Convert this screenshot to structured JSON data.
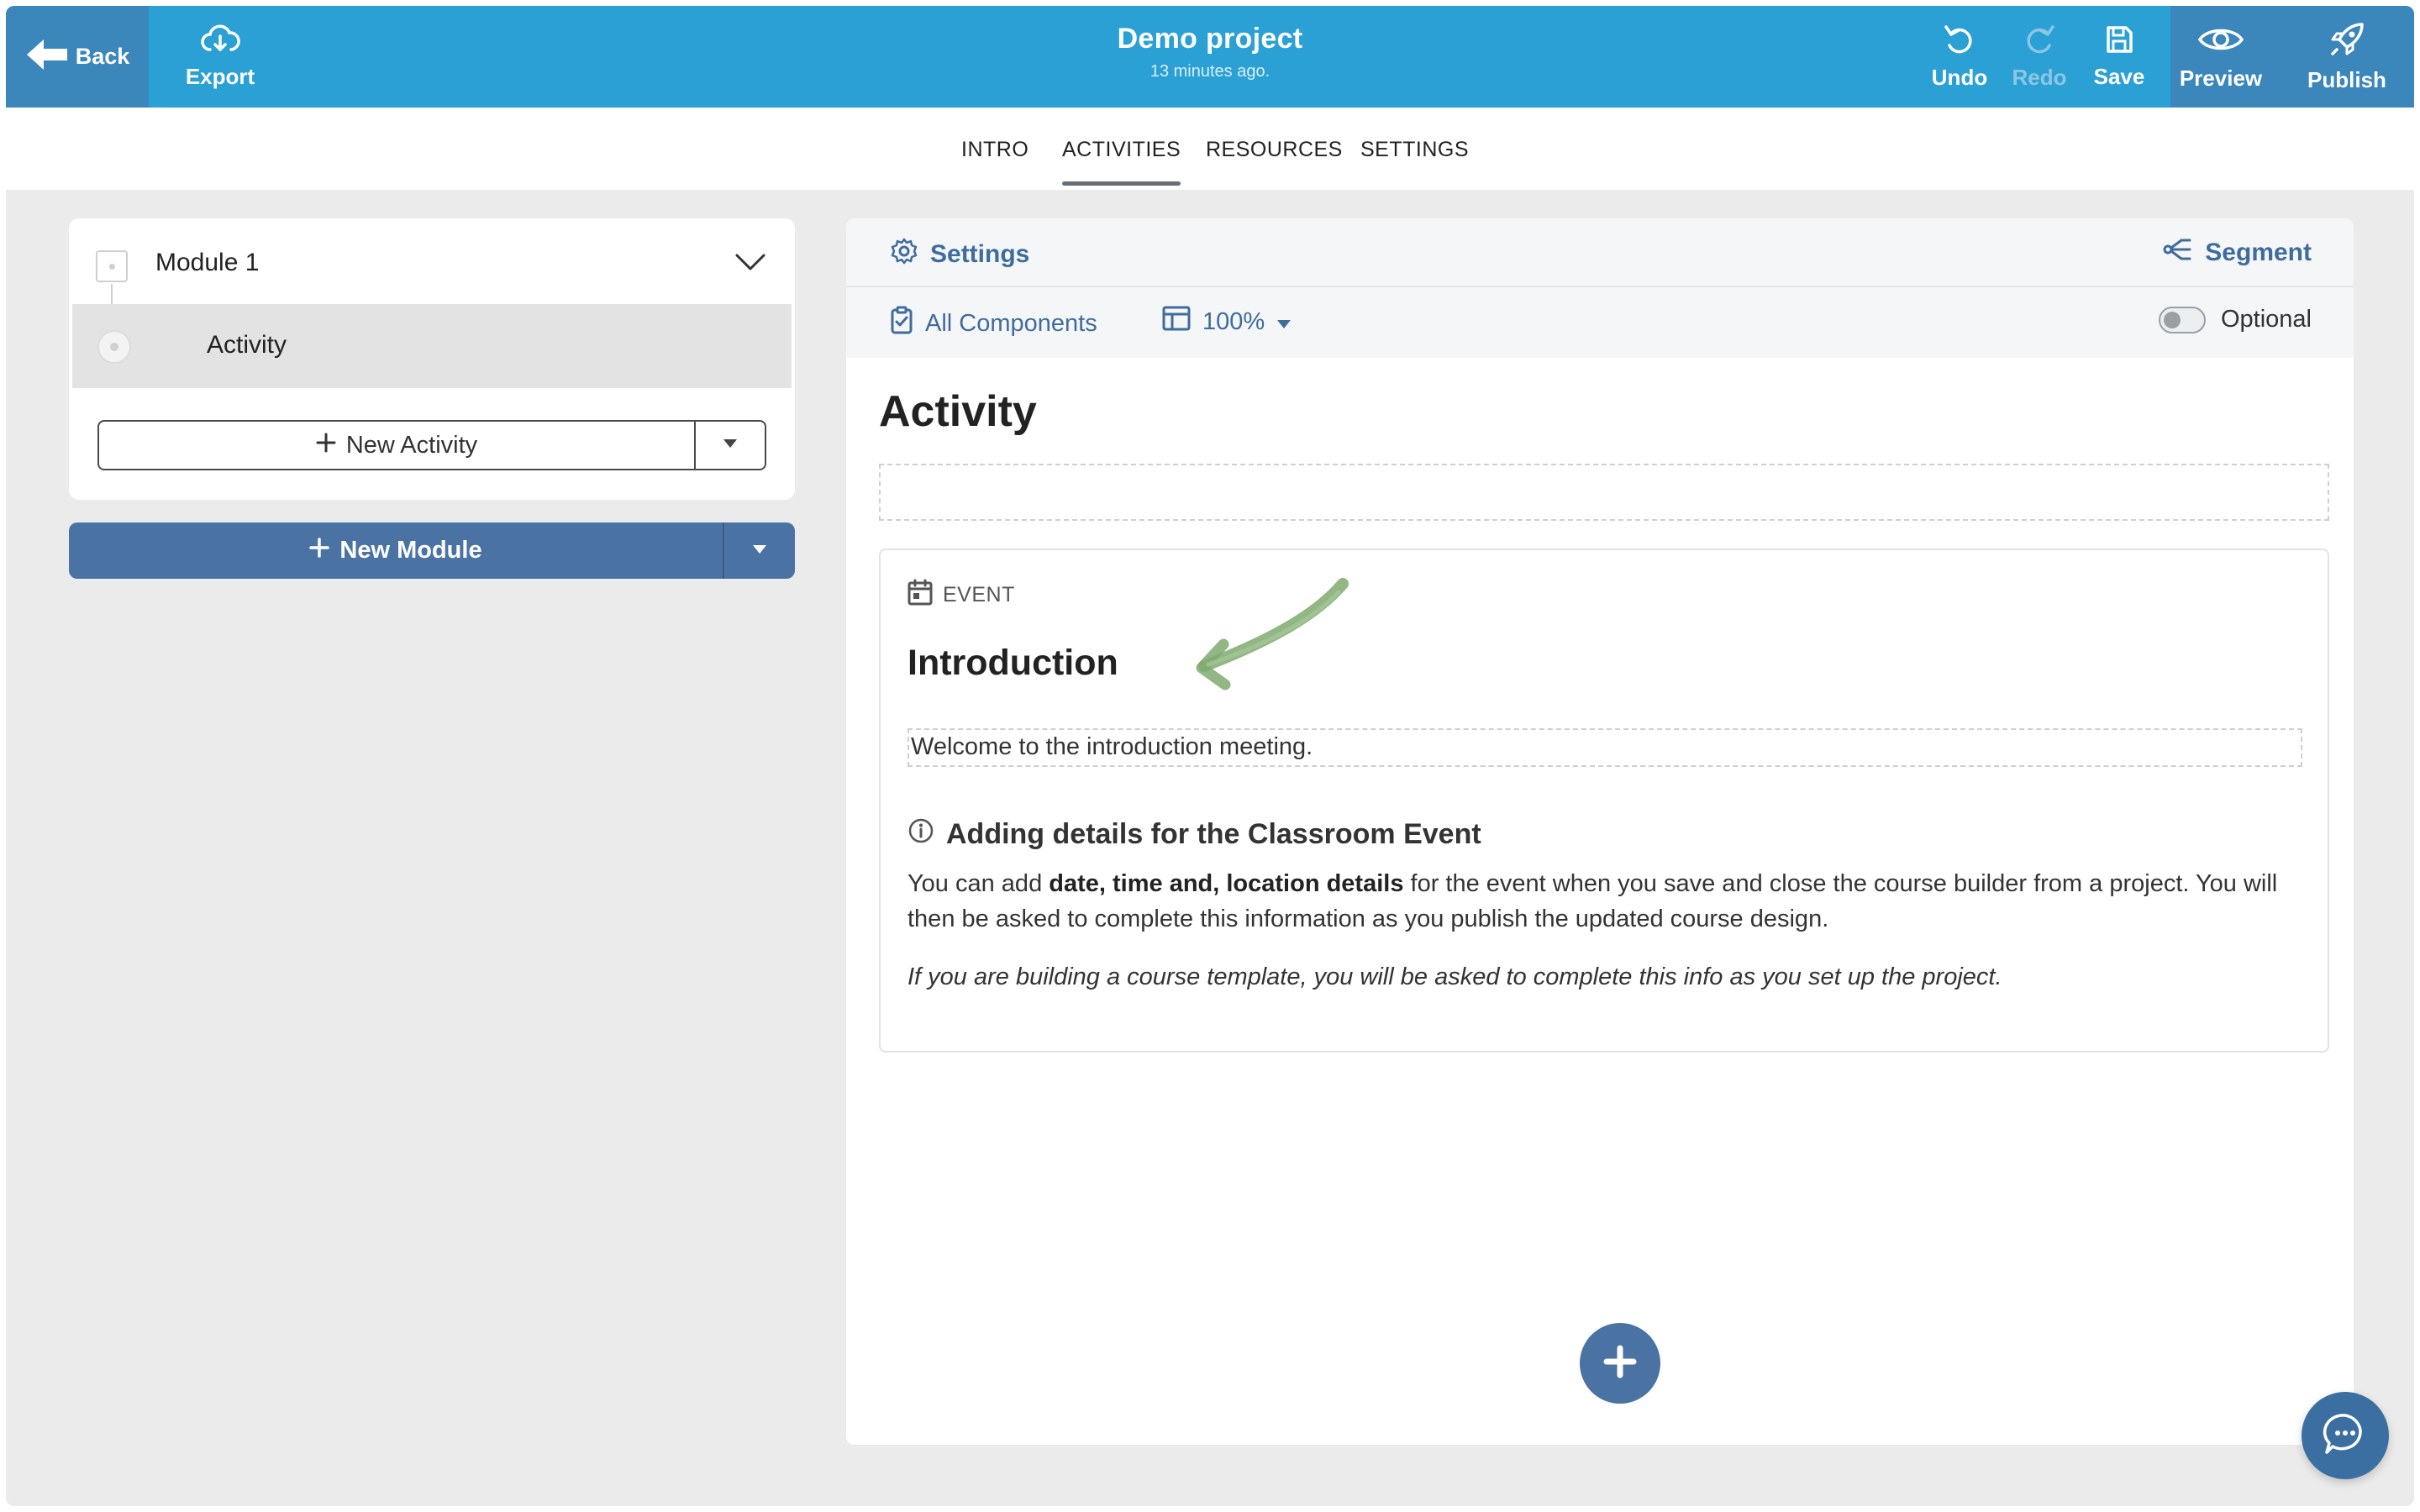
{
  "topbar": {
    "back_label": "Back",
    "export_label": "Export",
    "project_title": "Demo project",
    "saved_status": "13 minutes ago.",
    "undo_label": "Undo",
    "redo_label": "Redo",
    "save_label": "Save",
    "preview_label": "Preview",
    "publish_label": "Publish"
  },
  "tabs": [
    {
      "label": "INTRO",
      "active": false
    },
    {
      "label": "ACTIVITIES",
      "active": true
    },
    {
      "label": "RESOURCES",
      "active": false
    },
    {
      "label": "SETTINGS",
      "active": false
    }
  ],
  "sidebar": {
    "module_title": "Module 1",
    "activity_label": "Activity",
    "new_activity_label": "New Activity",
    "new_module_label": "New Module"
  },
  "editor": {
    "settings_label": "Settings",
    "segment_label": "Segment",
    "all_components_label": "All Components",
    "zoom_value": "100%",
    "optional_label": "Optional",
    "optional_enabled": false,
    "activity_heading": "Activity",
    "event": {
      "tag": "EVENT",
      "title": "Introduction",
      "description": "Welcome to the introduction meeting.",
      "info_heading": "Adding details for the Classroom Event",
      "info_p1_start": "You can add ",
      "info_p1_bold": "date, time and, location details",
      "info_p1_end": " for the event when you save and close the course builder from a project. You will then be asked to complete this information as you publish the updated course design.",
      "info_p2": "If you are building a course template, you will be asked to complete this info as you set up the project."
    }
  },
  "colors": {
    "topbar": "#2aa0d4",
    "topbar_dark": "#3b86bb",
    "primary": "#4a73a4",
    "link": "#3f6c9c",
    "annotation_arrow": "#7faa6f"
  },
  "icons": {
    "back": "arrow-left-icon",
    "export": "cloud-download-icon",
    "undo": "undo-icon",
    "redo": "redo-icon",
    "save": "floppy-disk-icon",
    "preview": "eye-icon",
    "publish": "rocket-icon",
    "settings": "gear-icon",
    "segment": "share-icon",
    "all_components": "clipboard-icon",
    "zoom": "layout-icon",
    "event": "calendar-icon",
    "info": "info-icon",
    "add": "plus-icon",
    "chat": "chat-icon"
  }
}
